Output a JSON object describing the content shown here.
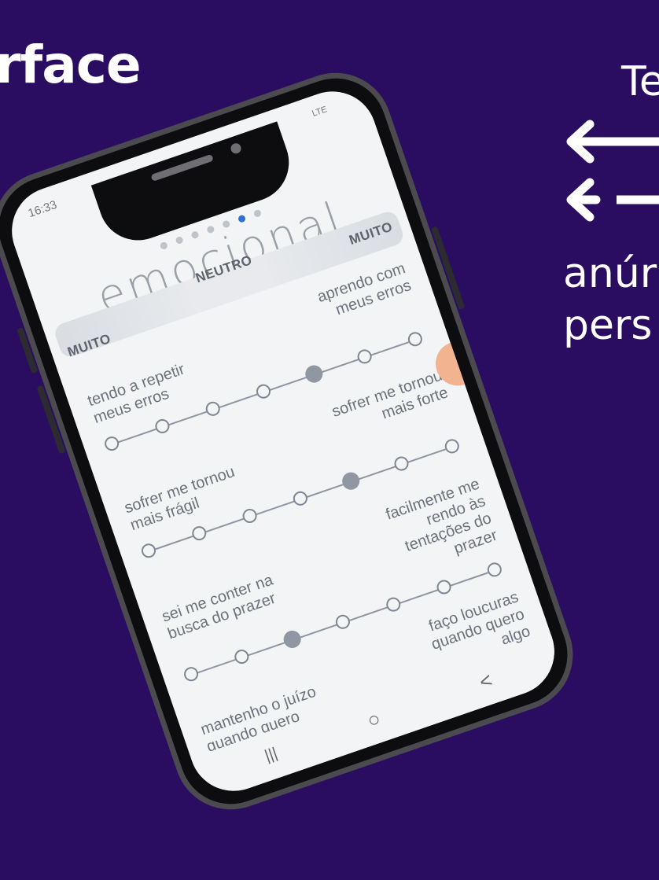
{
  "slide": {
    "heading": "rface",
    "right_text": {
      "line1": "Te",
      "line2": "anúr",
      "line3": "pers"
    }
  },
  "phone": {
    "status": {
      "time": "16:33",
      "icons": "LTE"
    },
    "pager": {
      "count": 7,
      "active_index": 5
    },
    "title": "emocional",
    "scale": {
      "left": "MUITO",
      "center": "NEUTRO",
      "right": "MUITO"
    },
    "pairs": [
      {
        "left": "tendo a repetir\nmeus erros",
        "right": "aprendo com\nmeus erros",
        "selected": 4
      },
      {
        "left": "sofrer me tornou\nmais frágil",
        "right": "sofrer me tornou\nmais forte",
        "selected": 4
      },
      {
        "left": "sei me conter na\nbusca do prazer",
        "right": "facilmente me\nrendo às\ntentações do\nprazer",
        "selected": 2
      },
      {
        "left": "mantenho o juízo\nquando quero\nalgo",
        "right": "faço loucuras\nquando quero\nalgo",
        "selected": -1
      }
    ],
    "nav": {
      "recent": "|||",
      "home": "○",
      "back": "<"
    }
  },
  "colors": {
    "background": "#2a0d61",
    "accent_dot": "#2e6fd0",
    "selected_dot": "#8f97a3",
    "side_tab": "#f2b391"
  }
}
